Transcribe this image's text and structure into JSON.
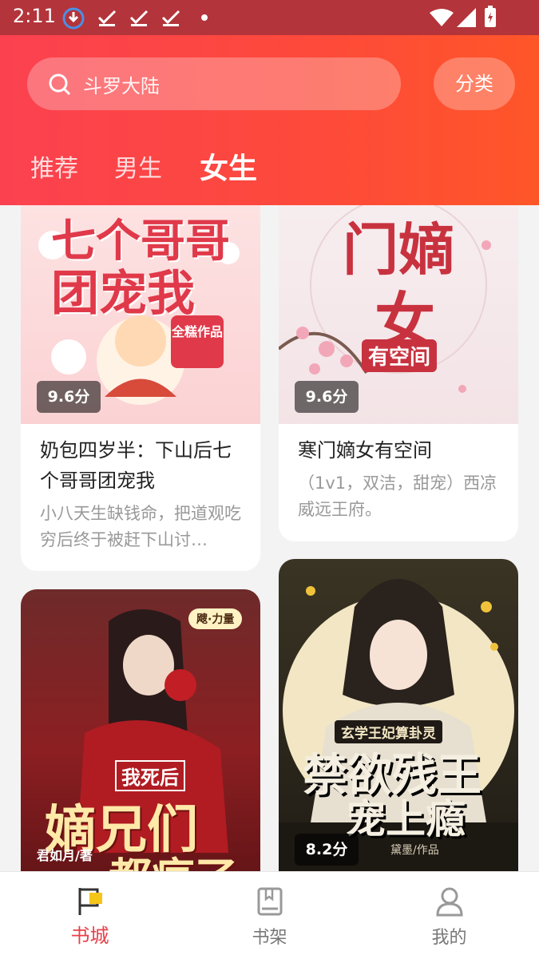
{
  "status_bar": {
    "time": "2:11"
  },
  "header": {
    "search_placeholder": "斗罗大陆",
    "category_button": "分类",
    "tabs": [
      {
        "label": "推荐",
        "active": false
      },
      {
        "label": "男生",
        "active": false
      },
      {
        "label": "女生",
        "active": true
      }
    ]
  },
  "books": [
    {
      "cover_text": [
        "七个哥哥",
        "团宠我"
      ],
      "cover_badge": "全糕作品",
      "score": "9.6分",
      "title": "奶包四岁半：下山后七个哥哥团宠我",
      "description": "小八天生缺钱命，把道观吃穷后终于被赶下山讨…"
    },
    {
      "cover_text": [
        "门嫡",
        "女",
        "有空间"
      ],
      "score": "9.6分",
      "title": "寒门嫡女有空间",
      "description": "（1v1，双洁，甜宠）西凉威远王府。"
    },
    {
      "cover_text": [
        "我死后",
        "嫡兄们",
        "都疯了"
      ],
      "cover_badge": "飕·力量",
      "cover_author": "君如月/著",
      "score": "",
      "title": "",
      "description": ""
    },
    {
      "cover_text": [
        "玄学王妃算卦灵",
        "禁欲残王",
        "宠上瘾"
      ],
      "cover_author": "黛墨/作品",
      "score": "8.2分",
      "title": "",
      "description": ""
    }
  ],
  "bottom_nav": [
    {
      "label": "书城",
      "icon": "flag-icon",
      "active": true
    },
    {
      "label": "书架",
      "icon": "book-icon",
      "active": false
    },
    {
      "label": "我的",
      "icon": "person-icon",
      "active": false
    }
  ],
  "colors": {
    "brand": "#fb4150",
    "active_nav": "#e8404a"
  }
}
